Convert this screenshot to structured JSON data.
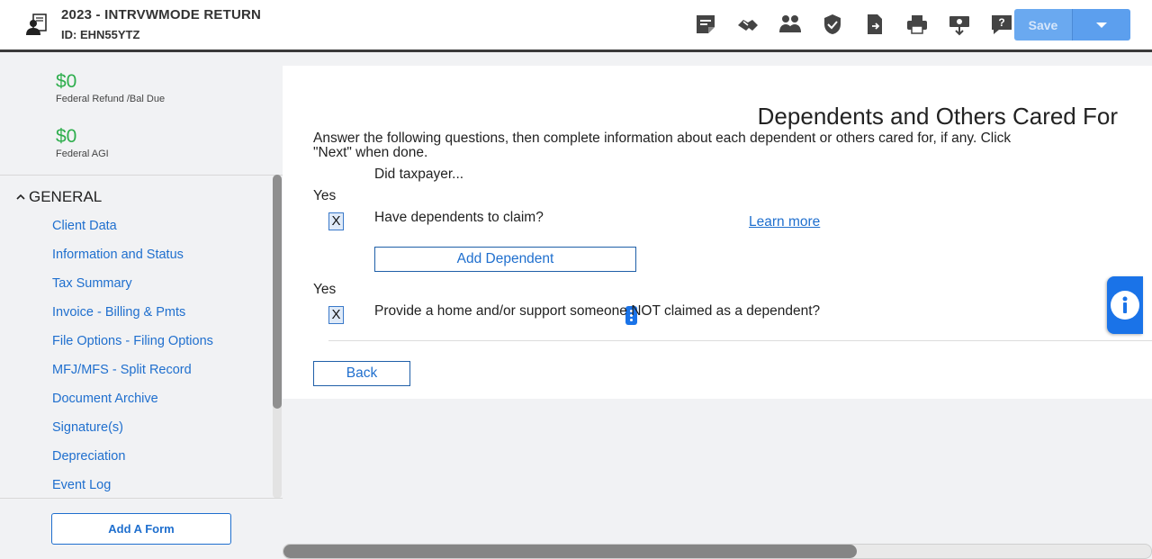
{
  "header": {
    "title": "2023 - INTRVWMODE RETURN",
    "return_id": "ID: EHN55YTZ",
    "logo_icon": "person-document-icon",
    "toolbar_icons": [
      "notes-icon",
      "handshake-icon",
      "people-icon",
      "shield-check-icon",
      "document-export-icon",
      "printer-icon",
      "money-download-icon",
      "help-icon"
    ],
    "save_label": "Save",
    "save_dropdown_icon": "chevron-down-icon"
  },
  "sidebar": {
    "refund_value": "$0",
    "refund_label": "Federal Refund /Bal Due",
    "agi_value": "$0",
    "agi_label": "Federal AGI",
    "section_title": "GENERAL",
    "section_icon": "chevron-up-icon",
    "items": [
      {
        "label": "Client Data"
      },
      {
        "label": "Information and Status"
      },
      {
        "label": "Tax Summary"
      },
      {
        "label": "Invoice - Billing & Pmts"
      },
      {
        "label": "File Options - Filing Options"
      },
      {
        "label": "MFJ/MFS - Split Record"
      },
      {
        "label": "Document Archive"
      },
      {
        "label": "Signature(s)"
      },
      {
        "label": "Depreciation"
      },
      {
        "label": "Event Log"
      }
    ],
    "add_form_label": "Add A Form"
  },
  "main": {
    "page_title": "Dependents and Others Cared For",
    "instructions": "Answer the following questions, then complete information about each dependent or others cared for, if any. Click \"Next\" when done.",
    "did_taxpayer": "Did taxpayer...",
    "yes_header_1": "Yes",
    "question_1": "Have dependents to claim?",
    "question_1_value": "X",
    "learn_more": "Learn more",
    "add_dependent_label": "Add Dependent",
    "yes_header_2": "Yes",
    "question_2": "Provide a home and/or support someone NOT claimed as a dependent?",
    "question_2_value": "X",
    "back_label": "Back"
  },
  "info_tab_icon": "info-icon",
  "colors": {
    "accent": "#1a73e8",
    "link": "#1f6fce",
    "money_green": "#2eae4d",
    "save_disabled": "#6aa9f0"
  }
}
